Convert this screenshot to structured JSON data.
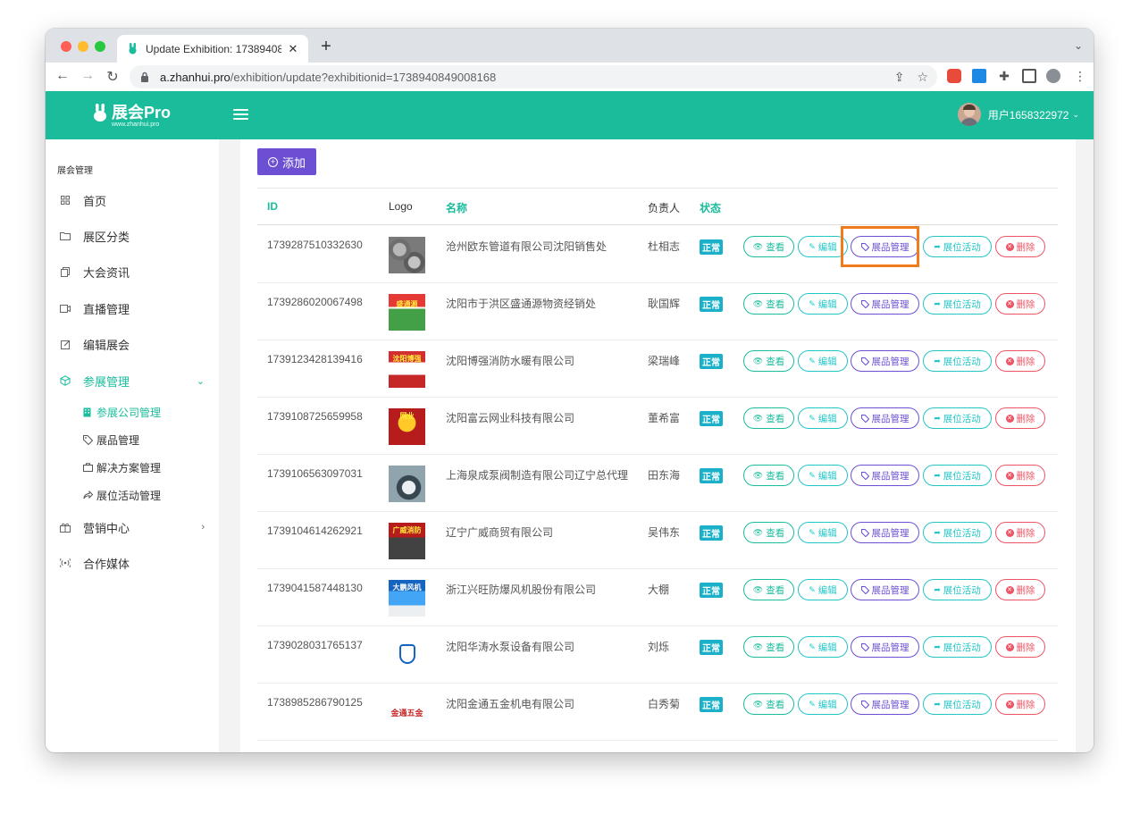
{
  "browser": {
    "tab_title": "Update Exhibition: 17389408",
    "url_domain": "a.zhanhui.pro",
    "url_path": "/exhibition/update?exhibitionid=1738940849008168"
  },
  "header": {
    "logo_text": "展会Pro",
    "logo_sub": "www.zhanhui.pro",
    "username": "用户1658322972"
  },
  "sidebar": {
    "heading": "展会管理",
    "items": [
      {
        "label": "首页",
        "icon": "grid-icon"
      },
      {
        "label": "展区分类",
        "icon": "folder-icon"
      },
      {
        "label": "大会资讯",
        "icon": "copy-icon"
      },
      {
        "label": "直播管理",
        "icon": "video-icon"
      },
      {
        "label": "编辑展会",
        "icon": "edit-icon"
      },
      {
        "label": "参展管理",
        "icon": "cube-icon"
      },
      {
        "label": "营销中心",
        "icon": "gift-icon"
      },
      {
        "label": "合作媒体",
        "icon": "broadcast-icon"
      }
    ],
    "subitems": [
      {
        "label": "参展公司管理",
        "icon": "building-icon"
      },
      {
        "label": "展品管理",
        "icon": "tag-icon"
      },
      {
        "label": "解决方案管理",
        "icon": "briefcase-icon"
      },
      {
        "label": "展位活动管理",
        "icon": "share-icon"
      }
    ]
  },
  "toolbar": {
    "add_label": "添加"
  },
  "table": {
    "headers": {
      "id": "ID",
      "logo": "Logo",
      "name": "名称",
      "manager": "负责人",
      "status": "状态"
    },
    "actions": {
      "view": "查看",
      "edit": "编辑",
      "products": "展品管理",
      "activities": "展位活动",
      "delete": "删除"
    },
    "rows": [
      {
        "id": "1739287510332630",
        "name": "沧州欧东管道有限公司沈阳销售处",
        "manager": "杜相志",
        "status": "正常",
        "logo_text": ""
      },
      {
        "id": "1739286020067498",
        "name": "沈阳市于洪区盛通源物资经销处",
        "manager": "耿国辉",
        "status": "正常",
        "logo_text": "盛通源"
      },
      {
        "id": "1739123428139416",
        "name": "沈阳博强消防水暖有限公司",
        "manager": "梁瑞峰",
        "status": "正常",
        "logo_text": "沈阳博强"
      },
      {
        "id": "1739108725659958",
        "name": "沈阳富云网业科技有限公司",
        "manager": "董希富",
        "status": "正常",
        "logo_text": "网业"
      },
      {
        "id": "1739106563097031",
        "name": "上海泉成泵阀制造有限公司辽宁总代理",
        "manager": "田东海",
        "status": "正常",
        "logo_text": ""
      },
      {
        "id": "1739104614262921",
        "name": "辽宁广威商贸有限公司",
        "manager": "吴伟东",
        "status": "正常",
        "logo_text": "广威消防"
      },
      {
        "id": "1739041587448130",
        "name": "浙江兴旺防爆风机股份有限公司",
        "manager": "大棚",
        "status": "正常",
        "logo_text": "大鹏风机"
      },
      {
        "id": "1739028031765137",
        "name": "沈阳华涛水泵设备有限公司",
        "manager": "刘烁",
        "status": "正常",
        "logo_text": ""
      },
      {
        "id": "1738985286790125",
        "name": "沈阳金通五金机电有限公司",
        "manager": "白秀菊",
        "status": "正常",
        "logo_text": "金通五金"
      }
    ]
  },
  "colors": {
    "brand": "#1abc9c",
    "primary": "#6c4fd3",
    "info": "#23c6c8",
    "danger": "#ed5565",
    "highlight": "#f07b1a"
  }
}
